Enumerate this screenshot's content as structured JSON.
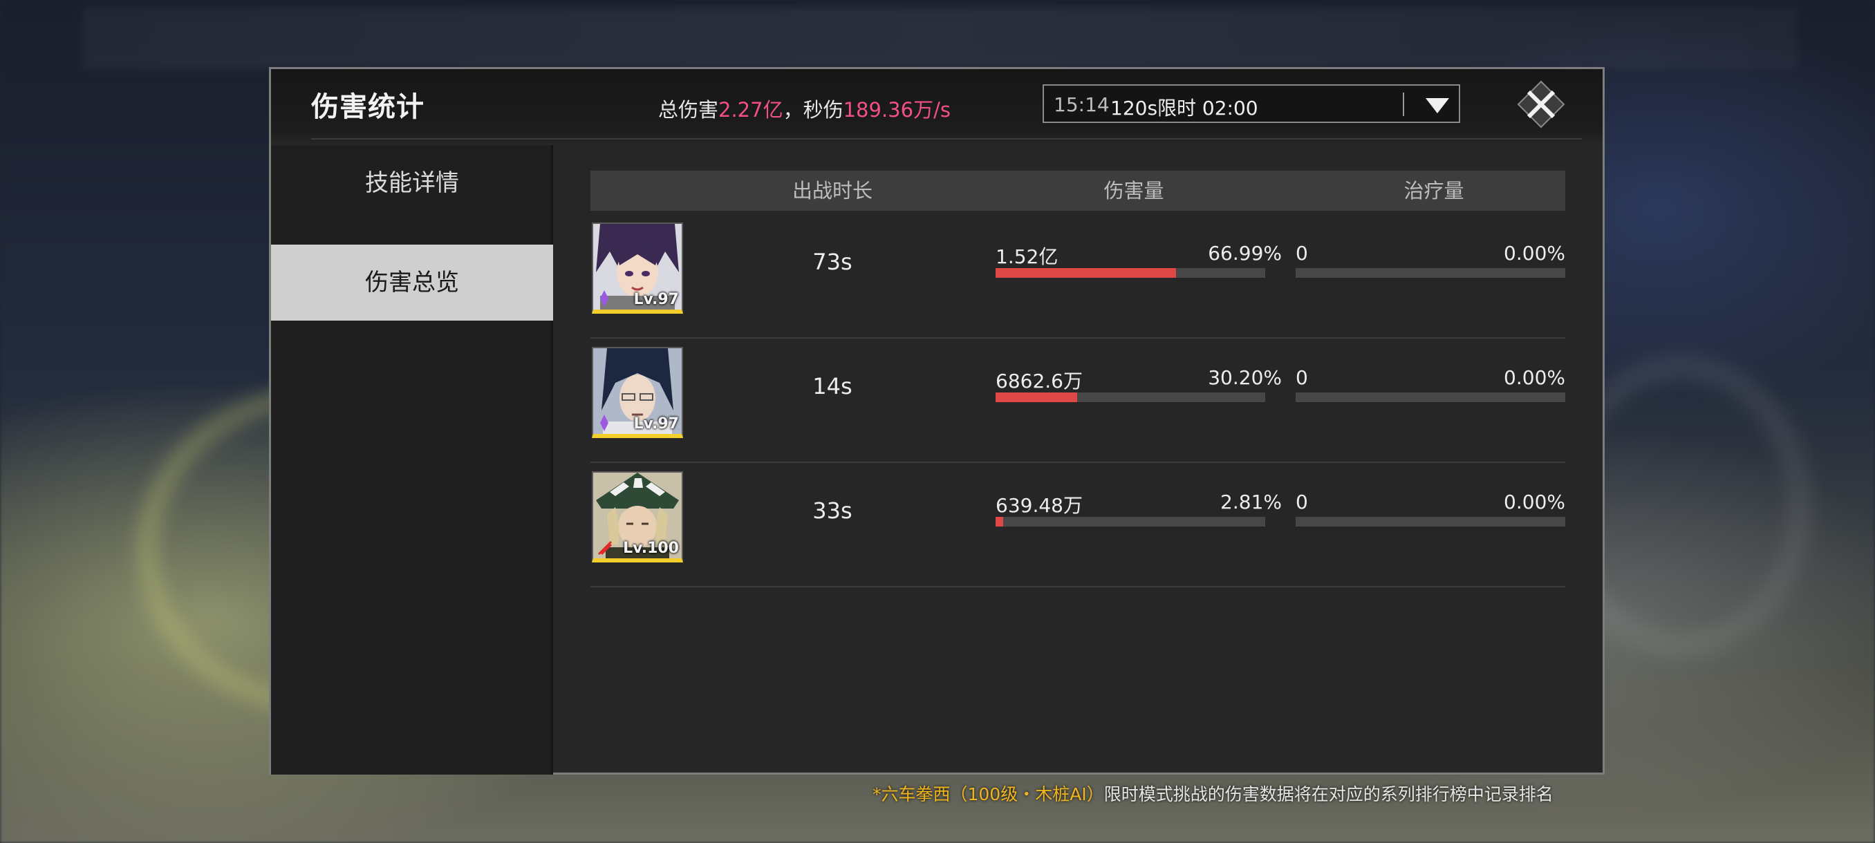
{
  "panel": {
    "title": "伤害统计",
    "summary": {
      "total_label": "总伤害",
      "total_value": "2.27亿",
      "sep": "，秒伤",
      "dps_value": "189.36万/s"
    },
    "dropdown": {
      "time": "15:14",
      "selected": "120s限时 02:00"
    }
  },
  "sidebar": {
    "items": [
      {
        "label": "技能详情",
        "active": false
      },
      {
        "label": "伤害总览",
        "active": true
      }
    ]
  },
  "table": {
    "headers": [
      "出战时长",
      "伤害量",
      "治疗量"
    ],
    "rows": [
      {
        "level": "Lv.97",
        "duration": "73s",
        "damage": "1.52亿",
        "damage_pct": "66.99%",
        "damage_ratio": 0.6699,
        "heal": "0",
        "heal_pct": "0.00%",
        "heal_ratio": 0
      },
      {
        "level": "Lv.97",
        "duration": "14s",
        "damage": "6862.6万",
        "damage_pct": "30.20%",
        "damage_ratio": 0.302,
        "heal": "0",
        "heal_pct": "0.00%",
        "heal_ratio": 0
      },
      {
        "level": "Lv.100",
        "duration": "33s",
        "damage": "639.48万",
        "damage_pct": "2.81%",
        "damage_ratio": 0.0281,
        "heal": "0",
        "heal_pct": "0.00%",
        "heal_ratio": 0
      }
    ]
  },
  "footer": {
    "highlight": "*六车拳西（100级・木桩AI）",
    "text": "限时模式挑战的伤害数据将在对应的系列排行榜中记录排名"
  },
  "colors": {
    "accent_pink": "#f24f8a",
    "bar_red": "#e04848",
    "gold": "#f0b41e",
    "avatar_border": "#f2cf2a"
  }
}
